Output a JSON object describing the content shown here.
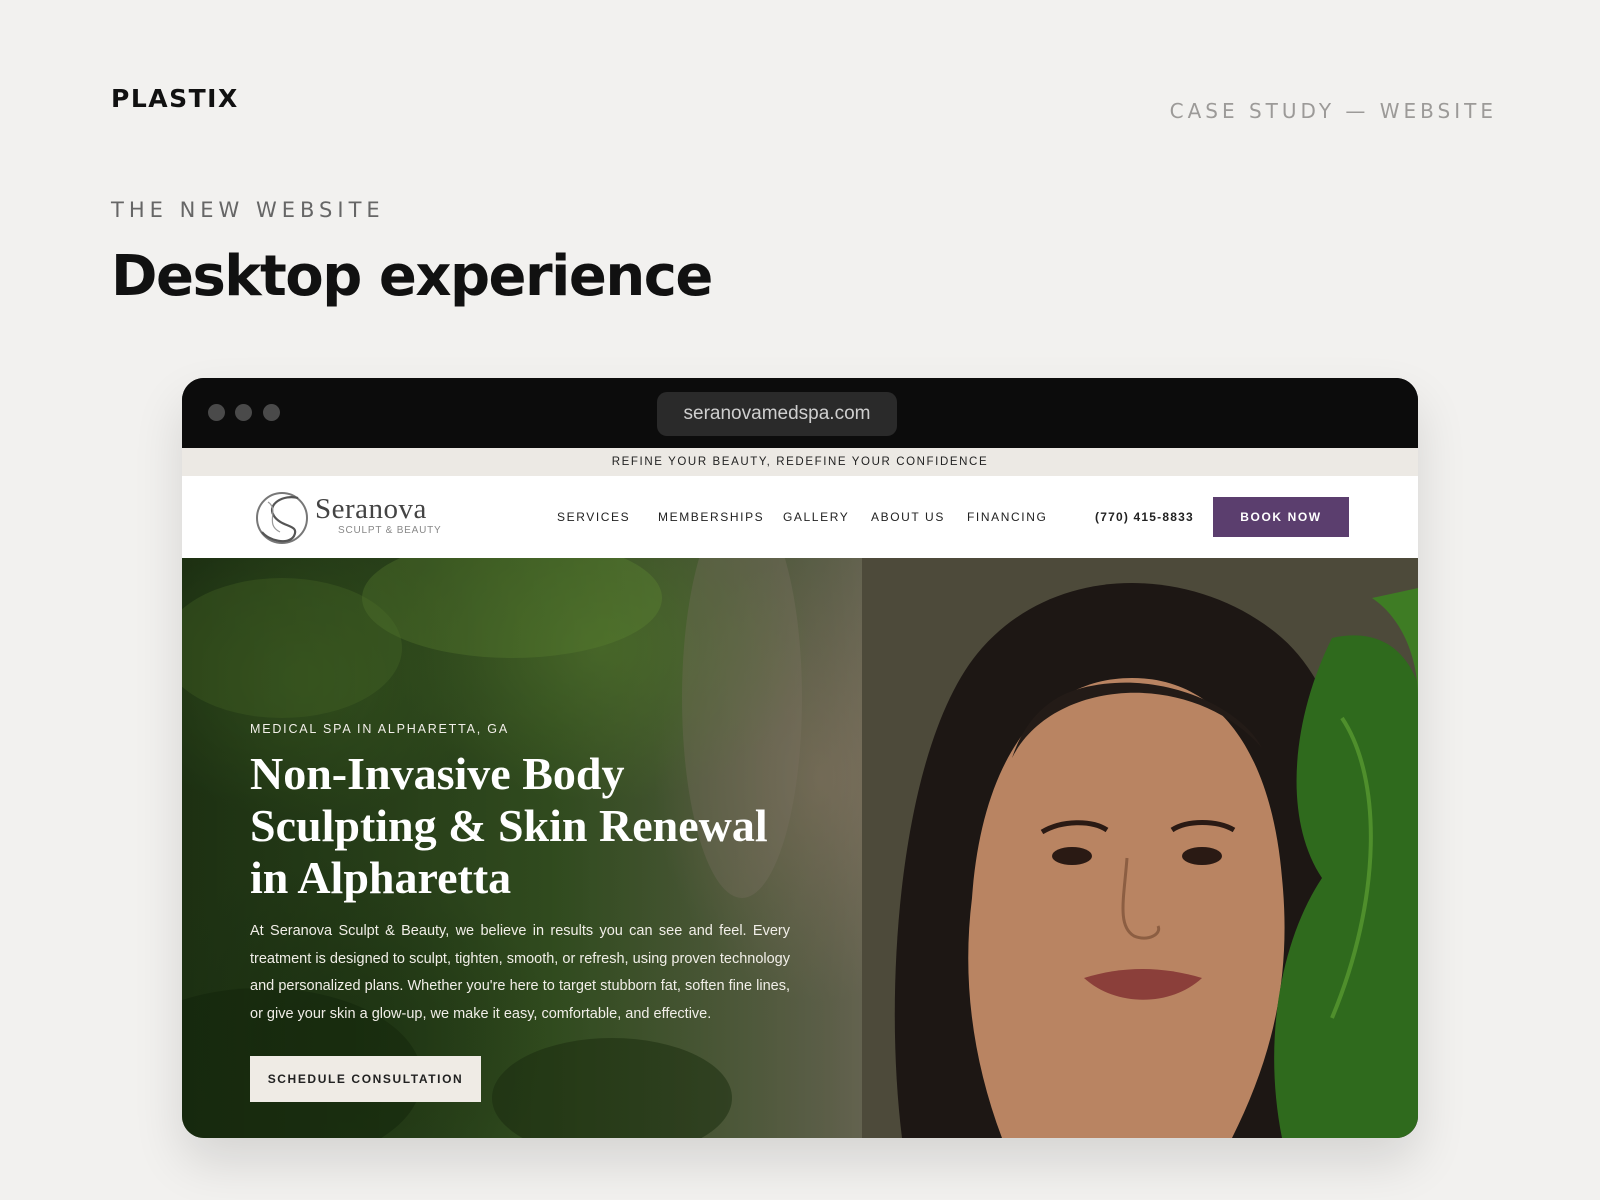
{
  "brand": {
    "name": "PLASTIX",
    "tag": "CASE STUDY — WEBSITE"
  },
  "section": {
    "eyebrow": "THE NEW WEBSITE",
    "title": "Desktop experience"
  },
  "browser": {
    "url": "seranovamedspa.com"
  },
  "site": {
    "announcement": "REFINE YOUR BEAUTY, REDEFINE YOUR CONFIDENCE",
    "logo": {
      "word": "Seranova",
      "sub": "SCULPT & BEAUTY"
    },
    "nav": {
      "items": [
        "SERVICES",
        "MEMBERSHIPS",
        "GALLERY",
        "ABOUT US",
        "FINANCING"
      ],
      "phone": "(770) 415-8833",
      "cta": "BOOK NOW"
    },
    "hero": {
      "kicker": "MEDICAL SPA IN ALPHARETTA, GA",
      "headline": "Non-Invasive Body Sculpting & Skin Renewal in Alpharetta",
      "body": "At Seranova Sculpt & Beauty, we believe in results you can see and feel. Every treatment is designed to sculpt, tighten, smooth, or refresh, using proven technology and personalized plans. Whether you're here to target stubborn fat, soften fine lines, or give your skin a glow-up, we make it easy, comfortable, and effective.",
      "cta": "SCHEDULE CONSULTATION"
    }
  },
  "colors": {
    "accent": "#5b3e6e",
    "page_bg": "#f2f1ef",
    "chrome": "#0c0c0c",
    "announcement_bg": "#ece9e4"
  }
}
